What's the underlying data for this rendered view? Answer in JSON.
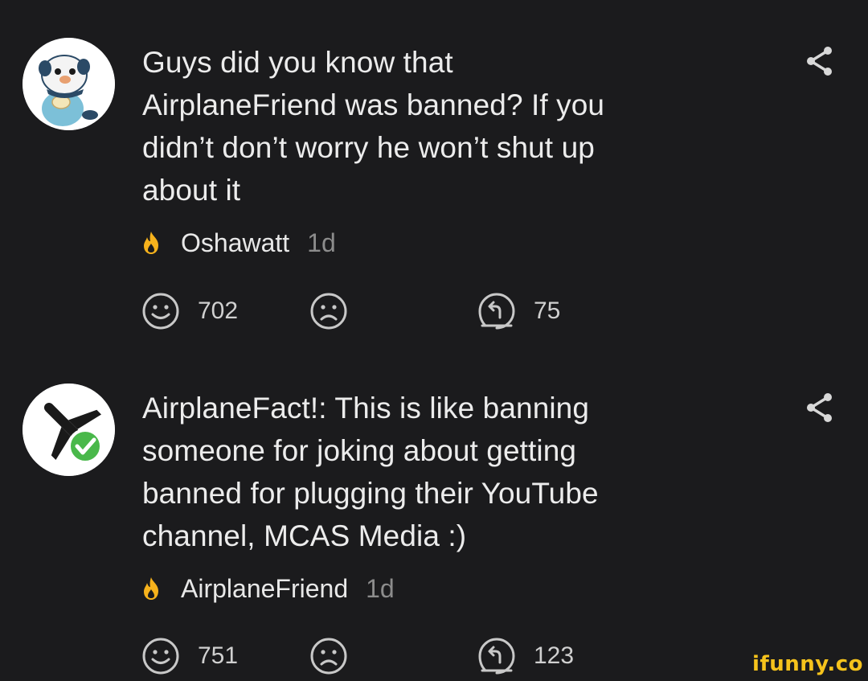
{
  "comments": [
    {
      "avatar": "oshawatt-avatar",
      "lines": [
        "Guys did you know that",
        "AirplaneFriend was banned? If you",
        "didn’t don’t worry he won’t shut up",
        "about it"
      ],
      "username": "Oshawatt",
      "time": "1d",
      "likes": "702",
      "replies": "75"
    },
    {
      "avatar": "airplane-verified-avatar",
      "lines": [
        "AirplaneFact!: This is like banning",
        "someone for joking about getting",
        "banned for plugging their YouTube",
        "channel, MCAS Media :)"
      ],
      "username": "AirplaneFriend",
      "time": "1d",
      "likes": "751",
      "replies": "123"
    }
  ],
  "icons": {
    "fire": "fire-icon",
    "smile": "smile-icon",
    "frown": "frown-icon",
    "reply": "reply-icon",
    "share": "share-icon"
  },
  "colors": {
    "background": "#1b1b1d",
    "text": "#ececec",
    "muted": "#8c8c8c",
    "fire": "#f6b21c",
    "verified": "#49b84a",
    "watermark": "#f6c31c"
  },
  "watermark": "ifunny.co"
}
